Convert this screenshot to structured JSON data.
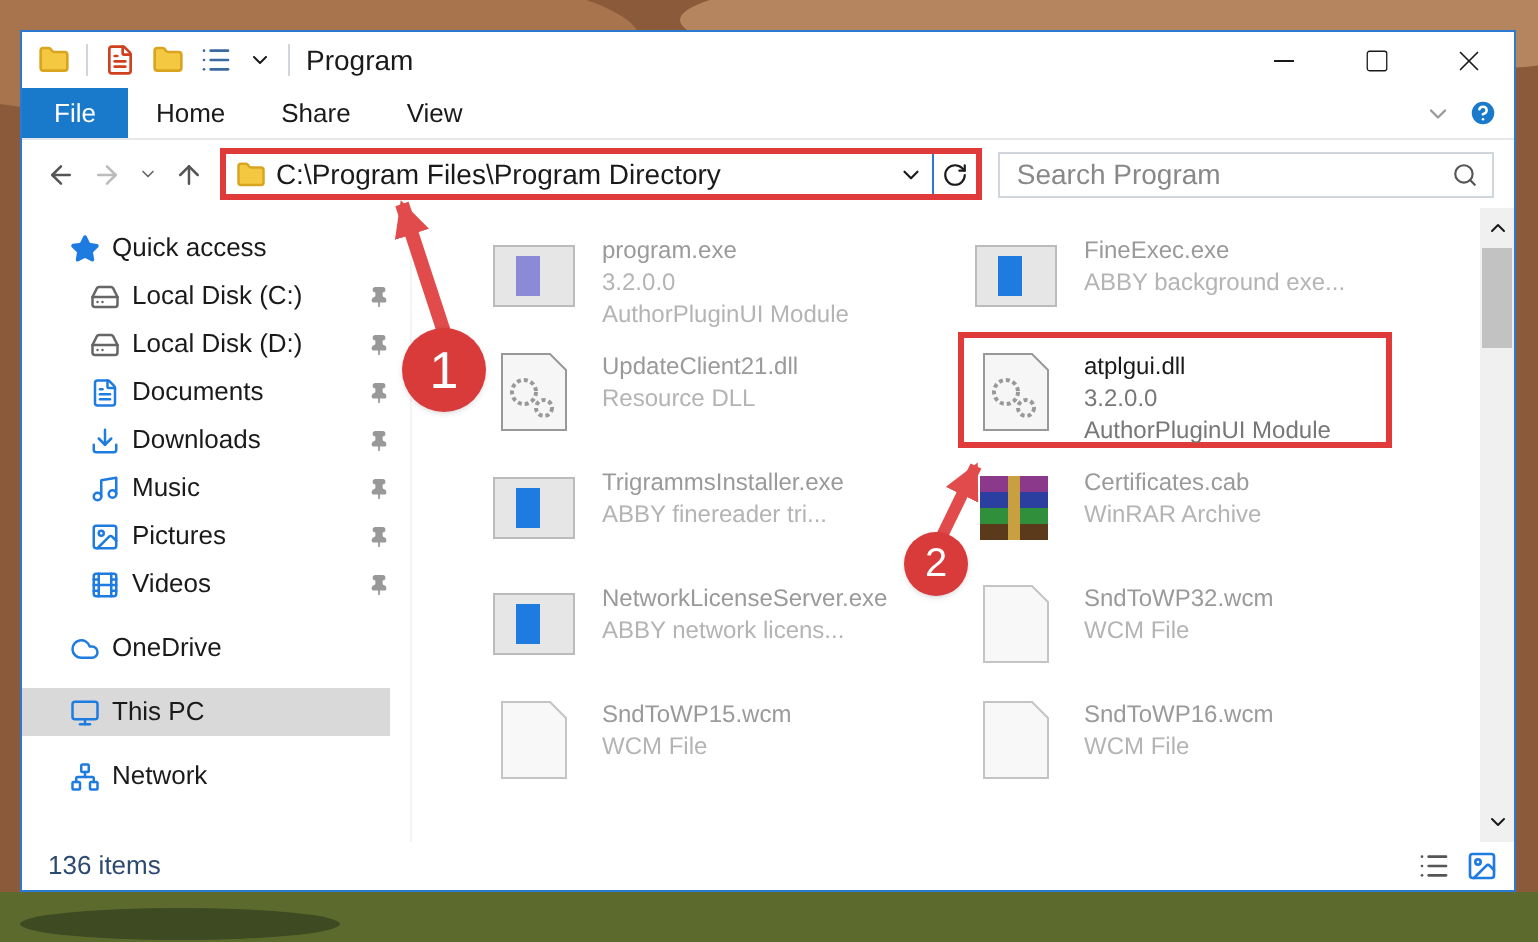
{
  "window": {
    "title": "Program"
  },
  "ribbon_tabs": [
    {
      "label": "File",
      "selected": true
    },
    {
      "label": "Home",
      "selected": false
    },
    {
      "label": "Share",
      "selected": false
    },
    {
      "label": "View",
      "selected": false
    }
  ],
  "address_bar": {
    "value": "C:\\Program Files\\Program Directory",
    "highlighted": true
  },
  "search": {
    "placeholder": "Search Program"
  },
  "sidebar": [
    {
      "label": "Quick access",
      "selected": false,
      "children": [
        {
          "label": "Local Disk (C:)",
          "pinned": true
        },
        {
          "label": "Local Disk (D:)",
          "pinned": true
        },
        {
          "label": "Documents",
          "pinned": true
        },
        {
          "label": "Downloads",
          "pinned": true
        },
        {
          "label": "Music",
          "pinned": true
        },
        {
          "label": "Pictures",
          "pinned": true
        },
        {
          "label": "Videos",
          "pinned": true
        }
      ]
    },
    {
      "label": "OneDrive",
      "selected": false
    },
    {
      "label": "This PC",
      "selected": true
    },
    {
      "label": "Network",
      "selected": false
    }
  ],
  "files": [
    {
      "kind": "installer",
      "name": "program.exe",
      "details": [
        "3.2.0.0",
        "AuthorPluginUI Module"
      ],
      "blurred": true,
      "highlighted": false
    },
    {
      "kind": "app",
      "name": "FineExec.exe",
      "details": [
        "ABBY background exe..."
      ],
      "blurred": true,
      "highlighted": false
    },
    {
      "kind": "dll",
      "name": "UpdateClient21.dll",
      "details": [
        "Resource DLL"
      ],
      "blurred": true,
      "highlighted": false
    },
    {
      "kind": "dll",
      "name": "atplgui.dll",
      "details": [
        "3.2.0.0",
        "AuthorPluginUI Module"
      ],
      "blurred": false,
      "highlighted": true
    },
    {
      "kind": "app",
      "name": "TrigrammsInstaller.exe",
      "details": [
        "ABBY finereader tri..."
      ],
      "blurred": true,
      "highlighted": false
    },
    {
      "kind": "archive",
      "name": "Certificates.cab",
      "details": [
        "WinRAR Archive"
      ],
      "blurred": true,
      "highlighted": false
    },
    {
      "kind": "app",
      "name": "NetworkLicenseServer.exe",
      "details": [
        "ABBY network licens..."
      ],
      "blurred": true,
      "highlighted": false
    },
    {
      "kind": "file",
      "name": "SndToWP32.wcm",
      "details": [
        "WCM File"
      ],
      "blurred": true,
      "highlighted": false
    },
    {
      "kind": "file",
      "name": "SndToWP15.wcm",
      "details": [
        "WCM File"
      ],
      "blurred": true,
      "highlighted": false
    },
    {
      "kind": "file",
      "name": "SndToWP16.wcm",
      "details": [
        "WCM File"
      ],
      "blurred": true,
      "highlighted": false
    }
  ],
  "status_bar": {
    "item_count": "136 items"
  },
  "annotations": [
    {
      "number": "1"
    },
    {
      "number": "2"
    }
  ]
}
